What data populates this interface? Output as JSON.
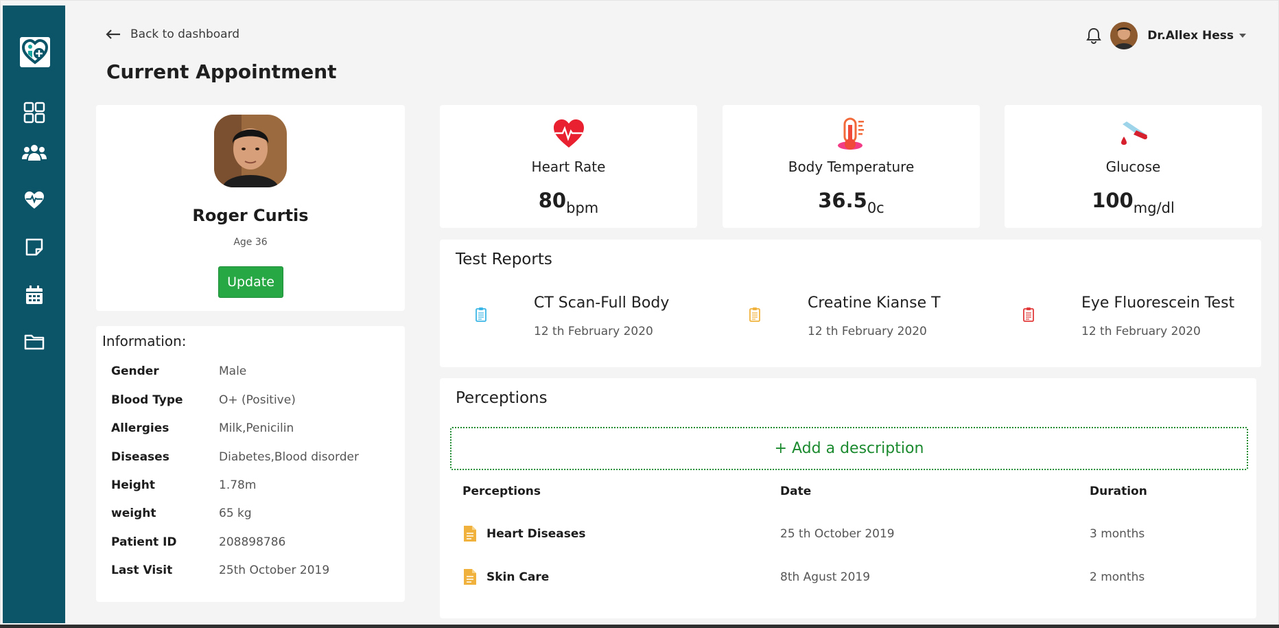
{
  "header": {
    "back_label": "Back to dashboard",
    "page_title": "Current Appointment",
    "user_name": "Dr.Allex Hess"
  },
  "sidebar": {
    "items": [
      {
        "name": "dashboard-grid-icon"
      },
      {
        "name": "users-icon"
      },
      {
        "name": "heart-pulse-icon"
      },
      {
        "name": "notes-icon"
      },
      {
        "name": "calendar-icon"
      },
      {
        "name": "folder-icon"
      }
    ]
  },
  "patient": {
    "name": "Roger Curtis",
    "age": "Age 36",
    "update_label": "Update"
  },
  "information": {
    "title": "Information:",
    "rows": [
      {
        "label": "Gender",
        "value": "Male"
      },
      {
        "label": "Blood Type",
        "value": "O+ (Positive)"
      },
      {
        "label": "Allergies",
        "value": "Milk,Penicilin"
      },
      {
        "label": "Diseases",
        "value": "Diabetes,Blood disorder"
      },
      {
        "label": "Height",
        "value": "1.78m"
      },
      {
        "label": "weight",
        "value": "65 kg"
      },
      {
        "label": "Patient ID",
        "value": "208898786"
      },
      {
        "label": "Last Visit",
        "value": "25th October 2019"
      }
    ]
  },
  "vitals": [
    {
      "label": "Heart Rate",
      "value": "80",
      "unit": "bpm",
      "icon": "heart-rate-icon"
    },
    {
      "label": "Body Temperature",
      "value": "36.5",
      "unit": "0c",
      "icon": "thermometer-icon"
    },
    {
      "label": "Glucose",
      "value": "100",
      "unit": "mg/dl",
      "icon": "glucose-icon"
    }
  ],
  "test_reports": {
    "title": "Test Reports",
    "items": [
      {
        "name": "CT Scan-Full Body",
        "date": "12 th February 2020",
        "color": "#3bb6e6"
      },
      {
        "name": "Creatine Kianse T",
        "date": "12 th February 2020",
        "color": "#f0b23c"
      },
      {
        "name": "Eye Fluorescein Test",
        "date": "12 th February 2020",
        "color": "#e23a3a"
      }
    ]
  },
  "perceptions": {
    "title": "Perceptions",
    "add_label": "+ Add a description",
    "columns": [
      "Perceptions",
      "Date",
      "Duration"
    ],
    "rows": [
      {
        "name": "Heart Diseases",
        "date": "25 th October 2019",
        "duration": "3 months"
      },
      {
        "name": "Skin Care",
        "date": "8th Agust 2019",
        "duration": "2 months"
      }
    ]
  },
  "colors": {
    "sidebar": "#0c5468",
    "accent_green": "#28a745",
    "dotted_border": "#1b8a2f",
    "file_icon": "#f0b23c"
  }
}
